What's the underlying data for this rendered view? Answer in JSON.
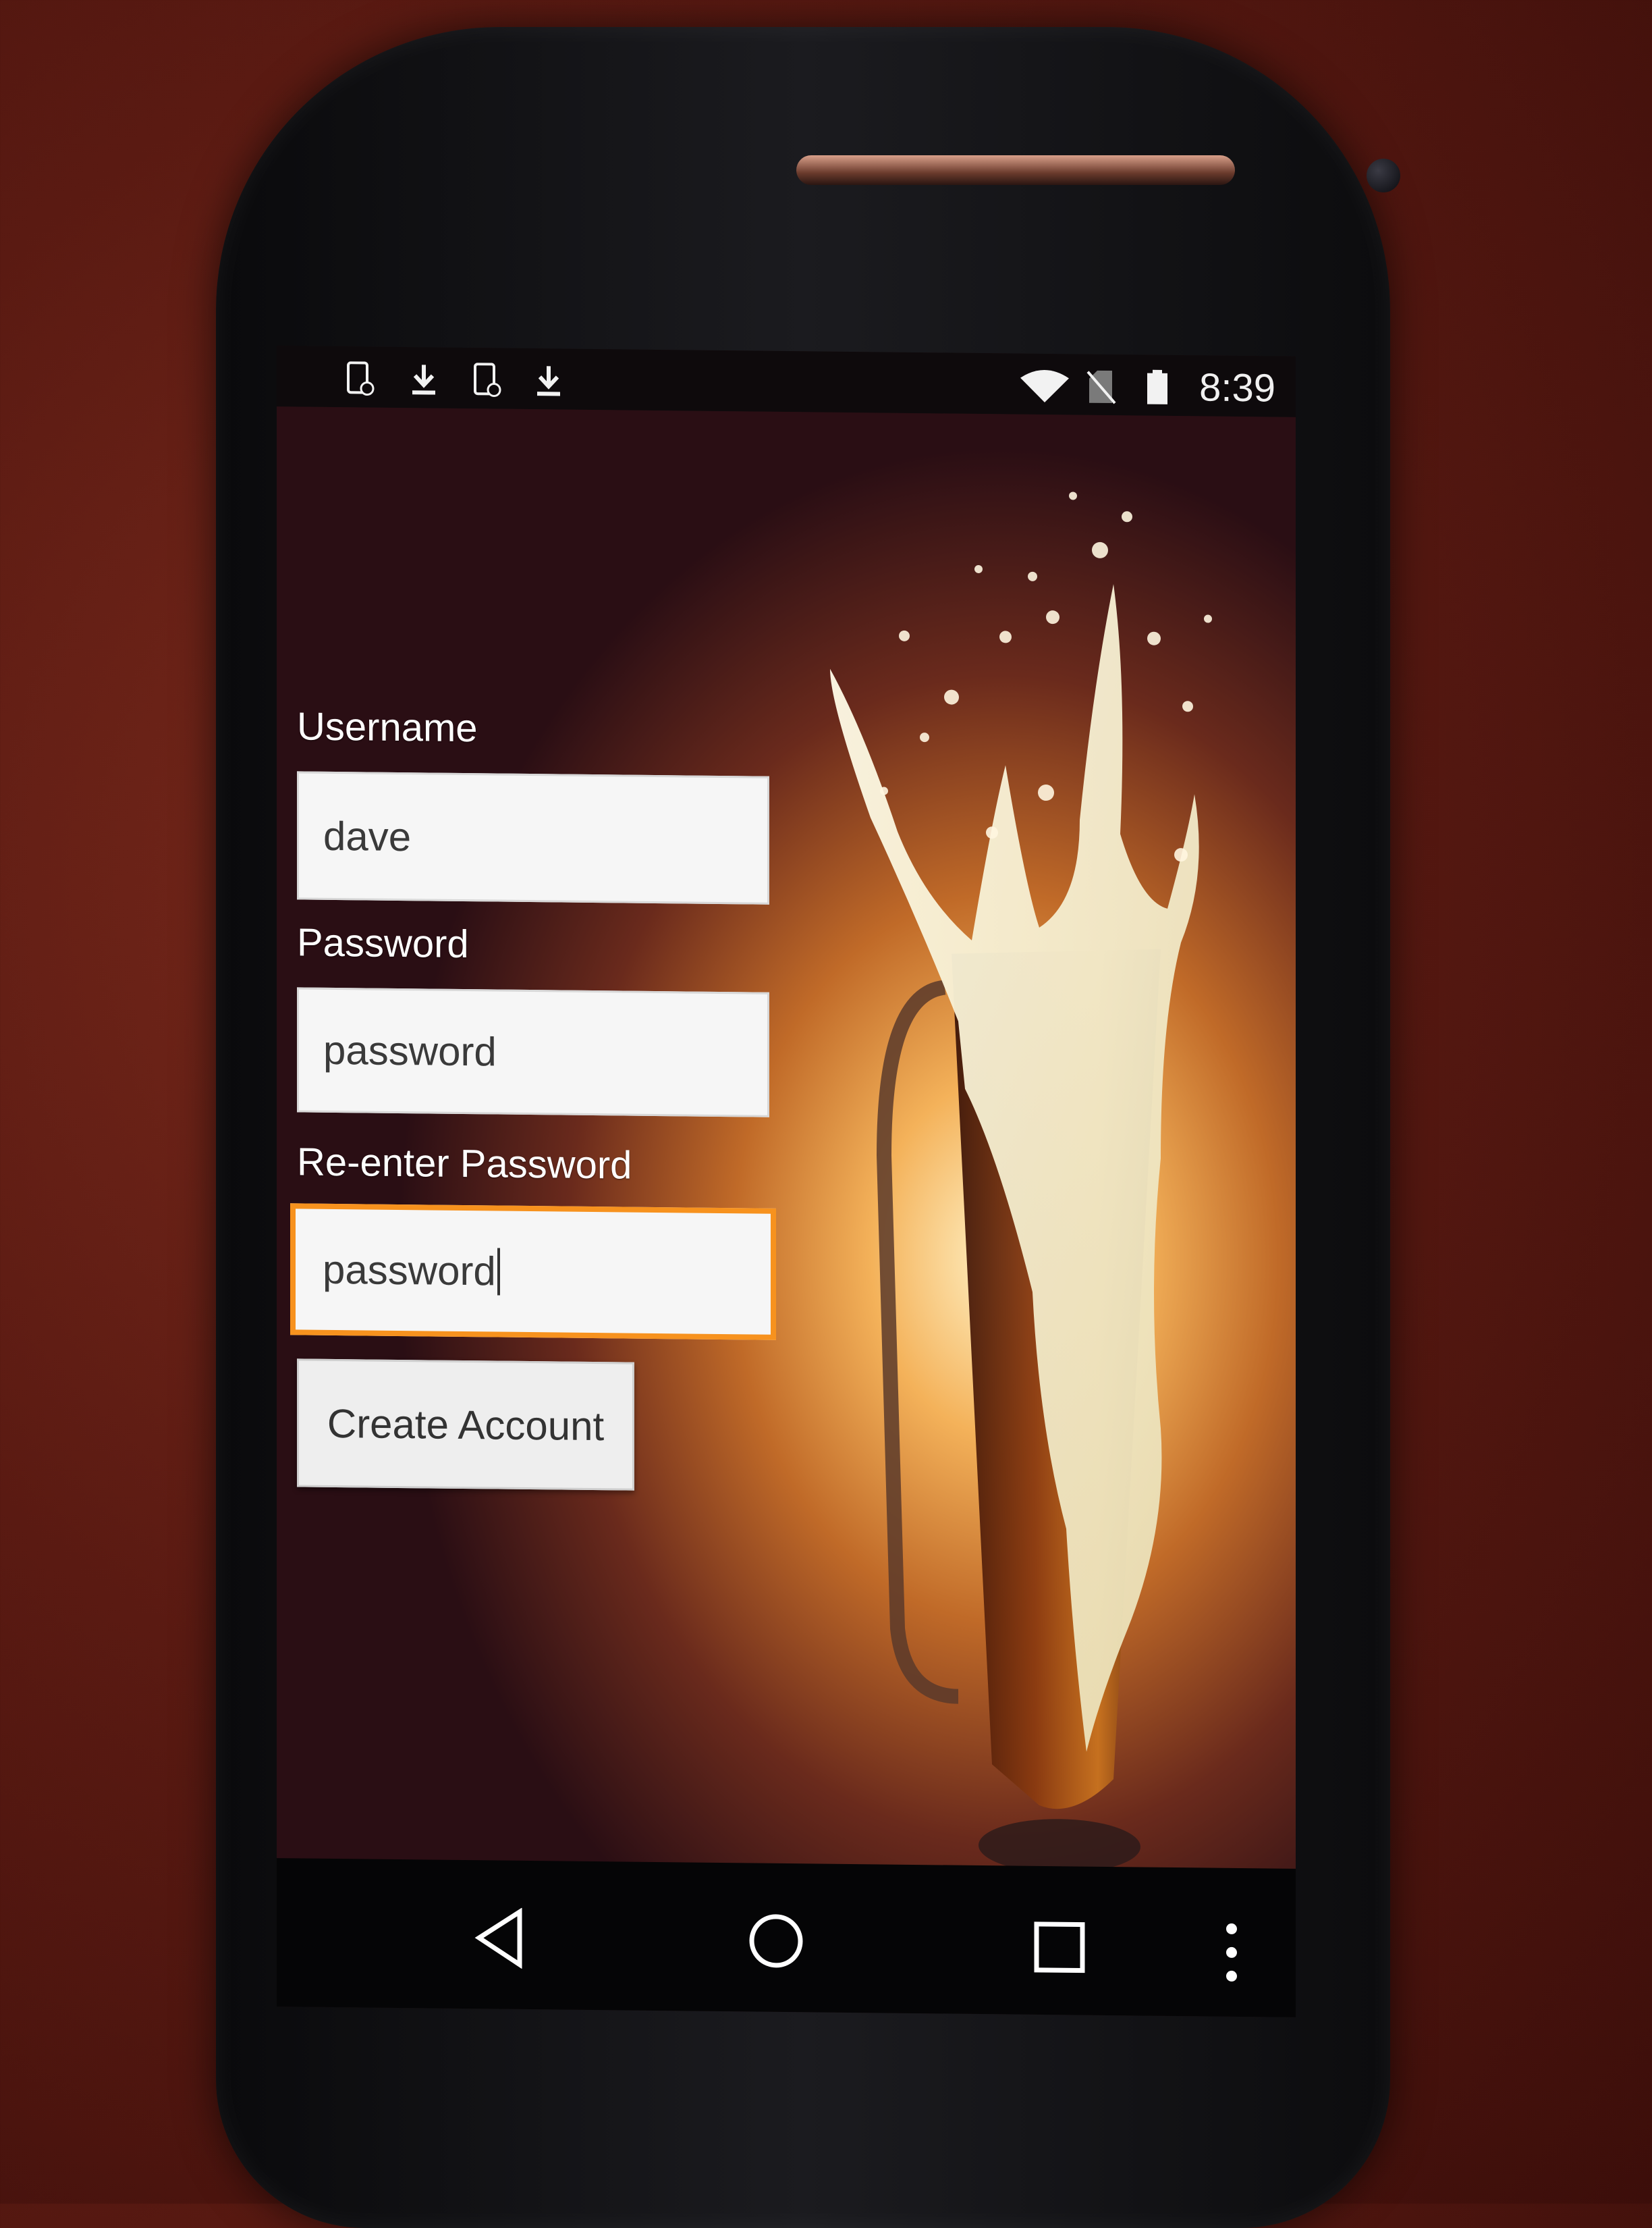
{
  "status_bar": {
    "notification_icons": [
      "phone-sync-icon",
      "download-icon",
      "phone-sync-icon",
      "download-icon"
    ],
    "system_icons": [
      "wifi-icon",
      "no-sim-icon",
      "battery-icon"
    ],
    "time": "8:39"
  },
  "form": {
    "username": {
      "label": "Username",
      "value": "dave"
    },
    "password": {
      "label": "Password",
      "value": "password"
    },
    "reenter_password": {
      "label": "Re-enter Password",
      "value": "password"
    },
    "create_button": "Create Account"
  },
  "nav_bar": {
    "buttons": [
      "back-icon",
      "home-icon",
      "recents-icon",
      "overflow-menu-icon"
    ]
  },
  "colors": {
    "focus_accent": "#f7921e",
    "background_glow": "#f4b25a"
  }
}
